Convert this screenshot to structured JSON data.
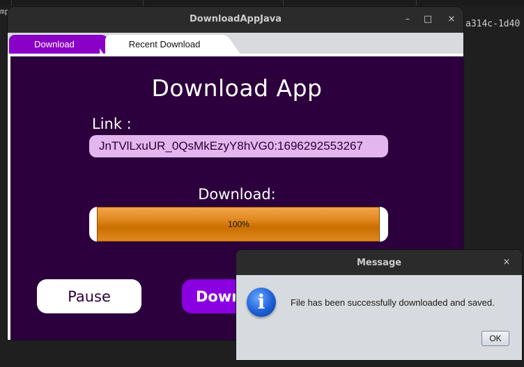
{
  "background": {
    "left_text": "mp",
    "right_text": "a314c-1d40"
  },
  "window": {
    "title": "DownloadAppJava",
    "controls": {
      "minimize": "–",
      "maximize": "□",
      "close": "×"
    }
  },
  "tabs": [
    {
      "label": "Download",
      "active": true
    },
    {
      "label": "Recent Download",
      "active": false
    }
  ],
  "main": {
    "heading": "Download App",
    "link_label": "Link :",
    "link_value": "JnTVlLxuUR_0QsMkEzyY8hVG0:1696292553267",
    "download_label": "Download:",
    "progress": {
      "value": 1.0,
      "text": "100%"
    },
    "pause_button": "Pause",
    "download_button": "Down"
  },
  "dialog": {
    "title": "Message",
    "close": "×",
    "icon": "info-icon",
    "icon_glyph": "i",
    "message": "File has been successfully downloaded and saved.",
    "ok_label": "OK"
  },
  "colors": {
    "content_bg": "#2c003c",
    "accent_purple": "#8a00e0",
    "link_field_bg": "#e3b6f0",
    "progress_orange": "#e18a20"
  }
}
